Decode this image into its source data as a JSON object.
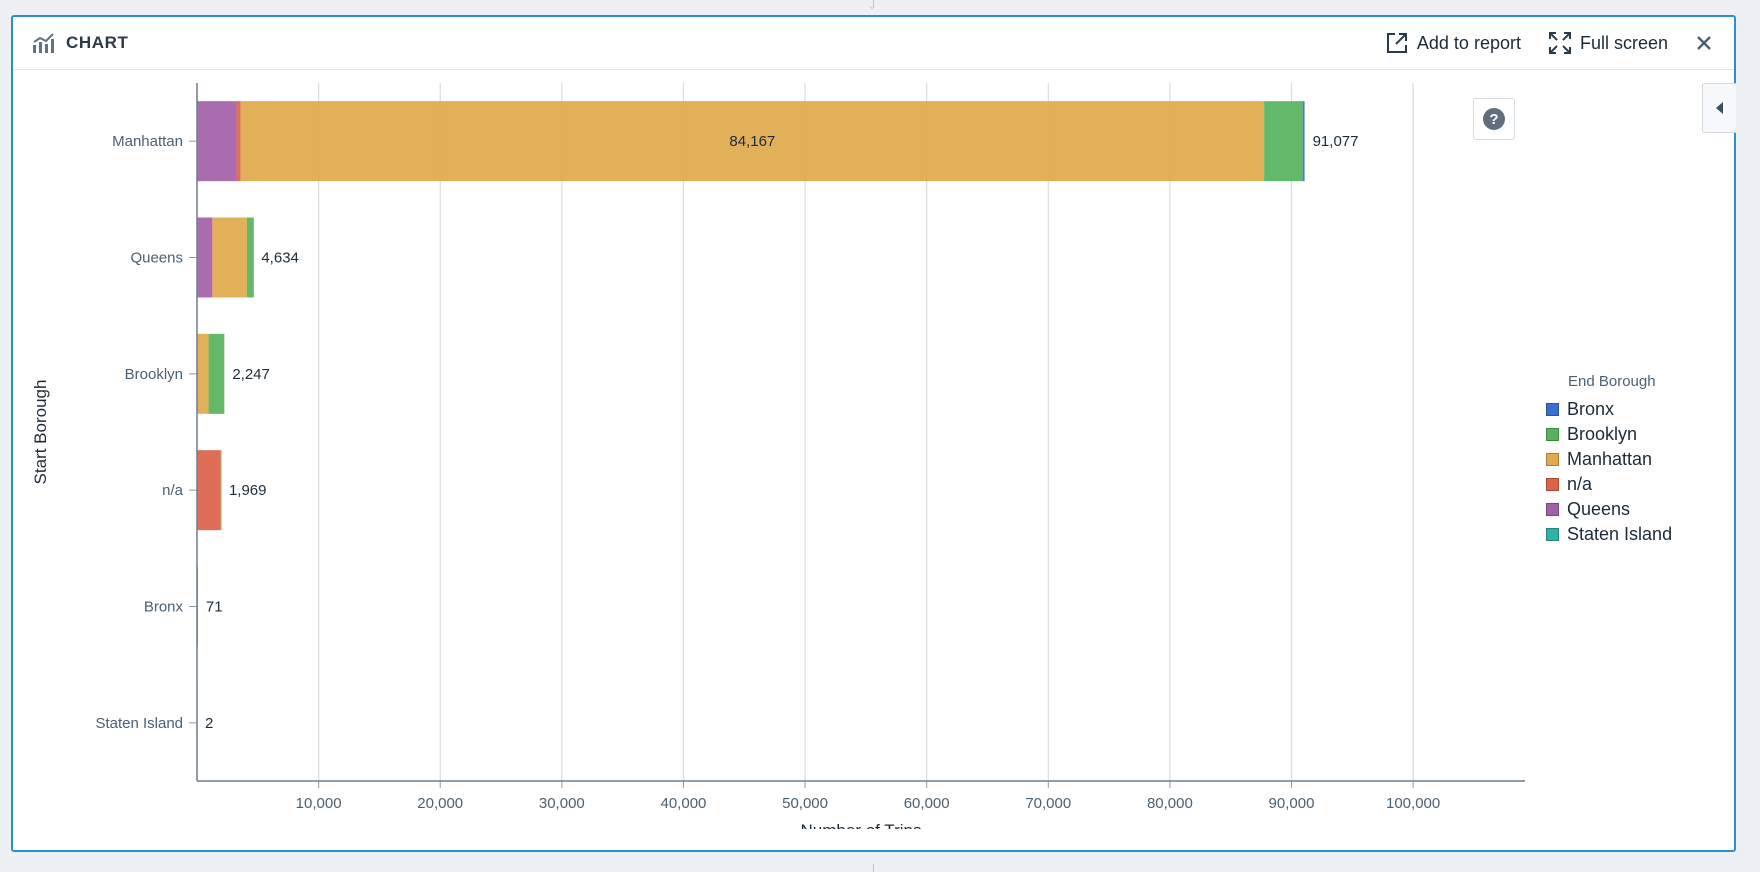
{
  "header": {
    "title": "CHART",
    "add_to_report": "Add to report",
    "full_screen": "Full screen"
  },
  "icons": {
    "chart": "chart-icon",
    "add_to_report": "external-link-icon",
    "full_screen": "expand-icon",
    "close": "close-icon",
    "help": "question-circle-icon",
    "side_toggle": "caret-left-icon"
  },
  "colors": {
    "accent": "#2d8ecf",
    "Bronx": "#3a6fd2",
    "Brooklyn": "#57b25c",
    "Manhattan": "#e0a94a",
    "n/a": "#dc6249",
    "Queens": "#a15fa8",
    "Staten Island": "#2fb3a2"
  },
  "legend": {
    "title": "End Borough",
    "items": [
      "Bronx",
      "Brooklyn",
      "Manhattan",
      "n/a",
      "Queens",
      "Staten Island"
    ]
  },
  "chart_data": {
    "type": "bar",
    "orientation": "horizontal",
    "stacked": true,
    "ylabel": "Start Borough",
    "xlabel": "Number of Trips",
    "categories": [
      "Manhattan",
      "Queens",
      "Brooklyn",
      "n/a",
      "Bronx",
      "Staten Island"
    ],
    "series": [
      {
        "name": "Queens",
        "values": [
          3250,
          1250,
          0,
          0,
          0,
          0
        ]
      },
      {
        "name": "n/a",
        "values": [
          330,
          50,
          0,
          1940,
          0,
          0
        ]
      },
      {
        "name": "Manhattan",
        "values": [
          84167,
          2800,
          950,
          20,
          0,
          0
        ]
      },
      {
        "name": "Brooklyn",
        "values": [
          3180,
          510,
          1297,
          9,
          0,
          0
        ]
      },
      {
        "name": "Bronx",
        "values": [
          150,
          24,
          0,
          0,
          71,
          0
        ]
      },
      {
        "name": "Staten Island",
        "values": [
          0,
          0,
          0,
          0,
          0,
          2
        ]
      }
    ],
    "totals": [
      "91,077",
      "4,634",
      "2,247",
      "1,969",
      "71",
      "2"
    ],
    "inner_labels": [
      {
        "category": "Manhattan",
        "series": "Manhattan",
        "text": "84,167"
      }
    ],
    "xticks": [
      10000,
      20000,
      30000,
      40000,
      50000,
      60000,
      70000,
      80000,
      90000,
      100000
    ],
    "xtick_labels": [
      "10,000",
      "20,000",
      "30,000",
      "40,000",
      "50,000",
      "60,000",
      "70,000",
      "80,000",
      "90,000",
      "100,000"
    ],
    "xlim": [
      0,
      109200
    ],
    "grid": true,
    "legend_position": "right"
  }
}
